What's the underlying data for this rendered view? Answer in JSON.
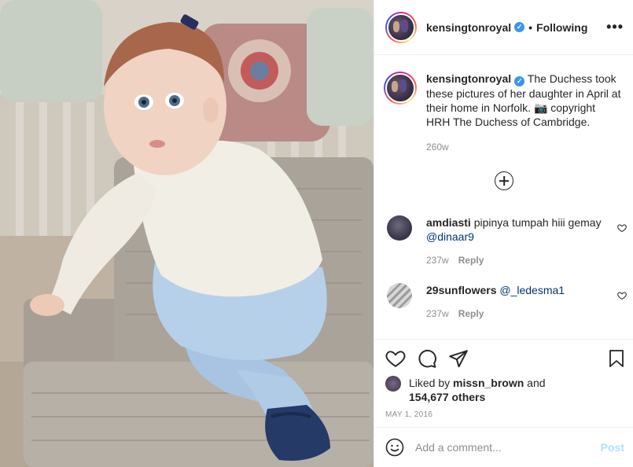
{
  "post": {
    "username": "kensingtonroyal",
    "verified_mark": "✓",
    "separator": "•",
    "follow_status": "Following",
    "more_label": "•••",
    "caption": "The Duchess took these pictures of her daughter in April at their home in Norfolk. 📷 copyright HRH The Duchess of Cambridge.",
    "caption_age": "260w"
  },
  "comments": [
    {
      "username": "amdiasti",
      "text": "pipinya tumpah hiii gemay ",
      "mention": "@dinaar9",
      "age": "237w",
      "reply_label": "Reply"
    },
    {
      "username": "29sunflowers",
      "text": "",
      "mention": "@_ledesma1",
      "age": "237w",
      "reply_label": "Reply"
    }
  ],
  "likes": {
    "prefix": "Liked by ",
    "user": "missn_brown",
    "middle": " and",
    "count": "154,677 others"
  },
  "date": "MAY 1, 2016",
  "add_comment": {
    "placeholder": "Add a comment...",
    "post_label": "Post"
  },
  "icons": [
    "heart-icon",
    "comment-icon",
    "share-icon",
    "bookmark-icon",
    "emoji-icon",
    "plus-circle-icon",
    "more-icon"
  ],
  "colors": {
    "verified": "#3897f0",
    "mention": "#00376b",
    "post_disabled": "#b2dffc",
    "muted": "#8e8e8e"
  }
}
